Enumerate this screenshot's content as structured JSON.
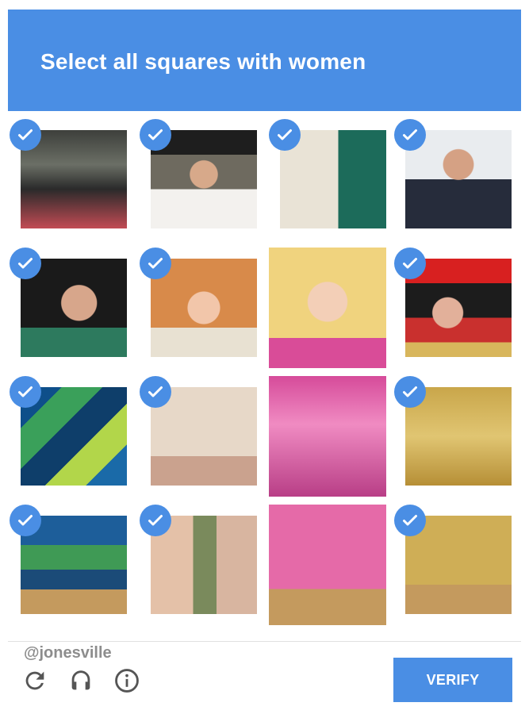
{
  "captcha": {
    "prompt": "Select all squares with women",
    "verify_label": "VERIFY",
    "watermark": "@jonesville",
    "accent_color": "#4a8ee4",
    "tiles": [
      {
        "row": 0,
        "col": 0,
        "selected": true,
        "desc": "women-group-left"
      },
      {
        "row": 0,
        "col": 1,
        "selected": true,
        "desc": "woman-black-hat"
      },
      {
        "row": 0,
        "col": 2,
        "selected": true,
        "desc": "two-women-white-green"
      },
      {
        "row": 0,
        "col": 3,
        "selected": true,
        "desc": "woman-striped-top"
      },
      {
        "row": 1,
        "col": 0,
        "selected": true,
        "desc": "woman-dark-hair-smiling"
      },
      {
        "row": 1,
        "col": 1,
        "selected": true,
        "desc": "woman-red-hair"
      },
      {
        "row": 1,
        "col": 2,
        "selected": false,
        "desc": "person-blonde-hair"
      },
      {
        "row": 1,
        "col": 3,
        "selected": true,
        "desc": "woman-red-hat-scarf"
      },
      {
        "row": 2,
        "col": 0,
        "selected": true,
        "desc": "green-blue-dress-lap"
      },
      {
        "row": 2,
        "col": 1,
        "selected": true,
        "desc": "cream-top-black-bow"
      },
      {
        "row": 2,
        "col": 2,
        "selected": false,
        "desc": "pink-dress-torso"
      },
      {
        "row": 2,
        "col": 3,
        "selected": true,
        "desc": "gold-jumpsuit"
      },
      {
        "row": 3,
        "col": 0,
        "selected": true,
        "desc": "green-blue-dress-legs"
      },
      {
        "row": 3,
        "col": 1,
        "selected": true,
        "desc": "legs-and-vase"
      },
      {
        "row": 3,
        "col": 2,
        "selected": false,
        "desc": "pink-dress-skirt"
      },
      {
        "row": 3,
        "col": 3,
        "selected": true,
        "desc": "gold-legs"
      }
    ],
    "icons": [
      "reload-icon",
      "headphones-icon",
      "info-icon"
    ]
  }
}
